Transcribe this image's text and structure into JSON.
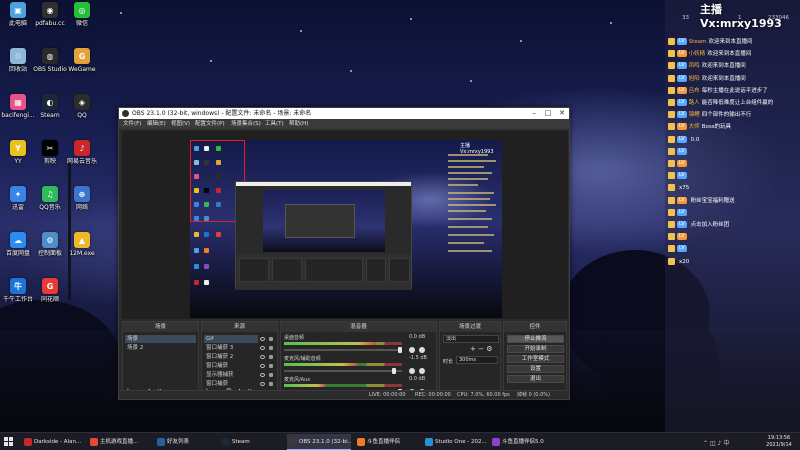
{
  "desktop": {
    "icons": [
      {
        "label": "此电脑",
        "color": "#4aa3df",
        "glyph": "▣",
        "icon": "computer-icon"
      },
      {
        "label": "pdfabu.cc",
        "color": "#2f2f2f",
        "glyph": "◉",
        "icon": "app-icon"
      },
      {
        "label": "微信",
        "color": "#25c03a",
        "glyph": "◎",
        "icon": "wechat-icon"
      },
      {
        "label": "回收站",
        "color": "#8fb8d8",
        "glyph": "♲",
        "icon": "recycle-bin-icon"
      },
      {
        "label": "OBS Studio",
        "color": "#2a2a2a",
        "glyph": "◍",
        "icon": "obs-icon"
      },
      {
        "label": "WeGame",
        "color": "#e2a43a",
        "glyph": "G",
        "icon": "wegame-icon"
      },
      {
        "label": "bacifengi...",
        "color": "#e7528a",
        "glyph": "▦",
        "icon": "app-icon"
      },
      {
        "label": "Steam",
        "color": "#1b2838",
        "glyph": "◐",
        "icon": "steam-icon"
      },
      {
        "label": "QQ",
        "color": "#2c2c2c",
        "glyph": "◈",
        "icon": "qq-icon"
      },
      {
        "label": "YY",
        "color": "#e8c020",
        "glyph": "Y",
        "icon": "yy-icon"
      },
      {
        "label": "剪映",
        "color": "#000000",
        "glyph": "✂",
        "icon": "capcut-icon"
      },
      {
        "label": "网易云音乐",
        "color": "#c8282c",
        "glyph": "♪",
        "icon": "music-icon"
      },
      {
        "label": "迅雷",
        "color": "#3a84e8",
        "glyph": "✦",
        "icon": "xunlei-icon"
      },
      {
        "label": "QQ音乐",
        "color": "#2fba5b",
        "glyph": "♫",
        "icon": "qq-music-icon"
      },
      {
        "label": "网络",
        "color": "#3d74c9",
        "glyph": "⊕",
        "icon": "network-icon"
      },
      {
        "label": "百度网盘",
        "color": "#2e8cf0",
        "glyph": "☁",
        "icon": "baidu-pan-icon"
      },
      {
        "label": "控制面板",
        "color": "#4d8ec8",
        "glyph": "⚙",
        "icon": "control-panel-icon"
      },
      {
        "label": "12M.exe",
        "color": "#f0b829",
        "glyph": "▲",
        "icon": "app-icon"
      },
      {
        "label": "千牛工作台",
        "color": "#1d74d8",
        "glyph": "牛",
        "icon": "qianniu-icon"
      },
      {
        "label": "同花顺",
        "color": "#e53a35",
        "glyph": "G",
        "icon": "stock-icon"
      }
    ]
  },
  "stream_overlay": {
    "title": "主播Vx:mrxy1993",
    "stat_left": "33",
    "stat_mid": "1",
    "stat_right": "233046",
    "chat": [
      {
        "nick": "Steam",
        "msg": "欢迎来到本直播间",
        "badge": "LV"
      },
      {
        "nick": "小妖精",
        "msg": "欢迎来到本直播间",
        "badge": "LV"
      },
      {
        "nick": "凤鸣",
        "msg": "欢迎来到本直播间",
        "badge": "LV"
      },
      {
        "nick": "旭阳",
        "msg": "欢迎来到本直播间",
        "badge": "LV"
      },
      {
        "nick": "吕布",
        "msg": "每秒主播在此说话平进步了",
        "badge": "LV"
      },
      {
        "nick": "路人",
        "msg": "能否降低难度让上台组件赢的",
        "badge": "LV"
      },
      {
        "nick": "锦鲤",
        "msg": "四个部件的输出不行",
        "badge": "LV"
      },
      {
        "nick": "大师",
        "msg": "Boss的玩具",
        "badge": "LV"
      },
      {
        "nick": "",
        "msg": "0.0",
        "badge": "LV"
      },
      {
        "nick": "",
        "msg": "",
        "badge": "LV"
      },
      {
        "nick": "",
        "msg": "",
        "badge": "LV"
      },
      {
        "nick": "",
        "msg": "",
        "badge": "LV"
      },
      {
        "nick": "",
        "msg": "x75",
        "badge": ""
      },
      {
        "nick": "",
        "msg": "粉丝宝宝福利赠送",
        "badge": "LV"
      },
      {
        "nick": "",
        "msg": "",
        "badge": "LV"
      },
      {
        "nick": "",
        "msg": "点击加入粉丝团",
        "badge": "LV"
      },
      {
        "nick": "",
        "msg": "",
        "badge": "LV"
      },
      {
        "nick": "",
        "msg": "",
        "badge": "LV"
      },
      {
        "nick": "",
        "msg": "x20",
        "badge": ""
      }
    ]
  },
  "obs": {
    "title": "OBS 23.1.0 (32-bit, windows) - 配置文件: 未命名 - 场景: 未命名",
    "menu": [
      "文件(F)",
      "编辑(E)",
      "视图(V)",
      "配置文件(P)",
      "场景集合(S)",
      "工具(T)",
      "帮助(H)"
    ],
    "preview_overlay_title": "主播Vx:mrxy1993",
    "docks": {
      "scenes": {
        "header": "场景",
        "items": [
          "场景",
          "场景 2"
        ]
      },
      "sources": {
        "header": "来源",
        "items": [
          "Gif",
          "窗口捕获 3",
          "窗口捕获 2",
          "窗口捕获",
          "显示器捕获",
          "窗口捕获"
        ]
      },
      "mixer": {
        "header": "混音器",
        "channels": [
          {
            "label": "桌面音频",
            "db": "0.0 dB",
            "level": 0.78
          },
          {
            "label": "麦克风/辅助音频",
            "db": "-1.5 dB",
            "level": 0.62
          },
          {
            "label": "麦克风/Aux",
            "db": "0.0 dB",
            "level": 0.35
          }
        ]
      },
      "transitions": {
        "header": "场景过渡",
        "type": "淡出",
        "duration_label": "时长",
        "duration": "300ms"
      },
      "controls": {
        "header": "控件",
        "buttons": [
          "停止推流",
          "开始录制",
          "工作室模式",
          "设置",
          "退出"
        ]
      }
    },
    "status": {
      "live": "LIVE: 00:00:00",
      "rec": "REC: 00:00:00",
      "cpu": "CPU: 7.0%, 60.00 fps",
      "dropped": "掉帧 0 (0.0%)"
    }
  },
  "taskbar": {
    "items": [
      {
        "label": "Darkside - Alan...",
        "color": "#c8282c"
      },
      {
        "label": "主机游戏直播...",
        "color": "#e34a3a"
      },
      {
        "label": "好友列表",
        "color": "#2a5f9e"
      },
      {
        "label": "Steam",
        "color": "#1b2838"
      },
      {
        "label": "OBS 23.1.0 (32-bi...",
        "color": "#3a3a3a"
      },
      {
        "label": "斗鱼直播伴侣",
        "color": "#f07c2a"
      },
      {
        "label": "Studio One - 202...",
        "color": "#2b8fd6"
      },
      {
        "label": "斗鱼直播伴侣5.0",
        "color": "#8e44c9"
      }
    ],
    "time": "19:13:56",
    "date": "2021/9/14"
  },
  "colors": {
    "accent": "#8fb3ff",
    "obs_bg": "#2b2b2b",
    "chat_nick": "#f6b73c"
  }
}
